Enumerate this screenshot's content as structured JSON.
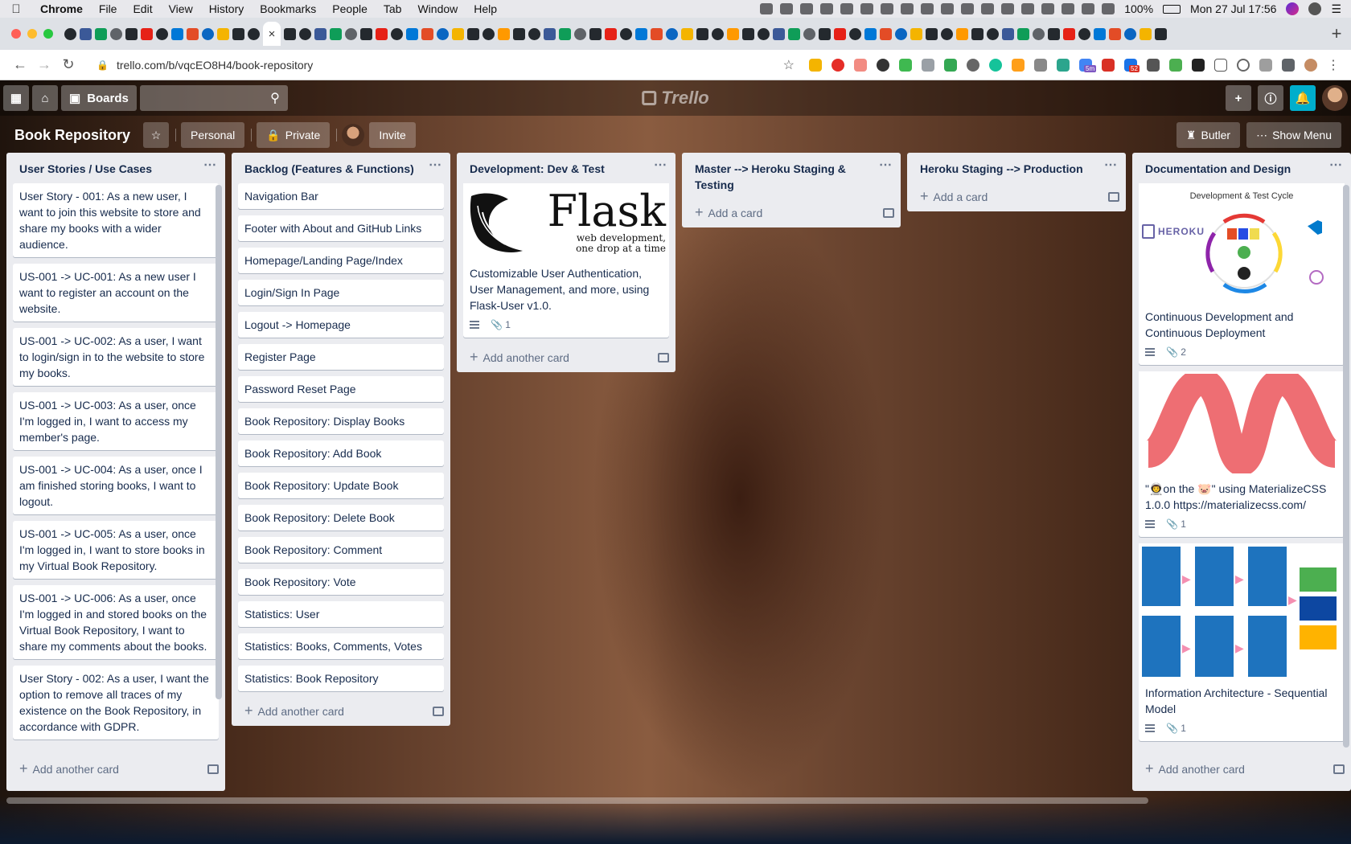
{
  "menubar": {
    "app": "Chrome",
    "items": [
      "File",
      "Edit",
      "View",
      "History",
      "Bookmarks",
      "People",
      "Tab",
      "Window",
      "Help"
    ],
    "battery": "100%",
    "datetime": "Mon 27 Jul  17:56"
  },
  "browser": {
    "url": "trello.com/b/vqcEO8H4/book-repository",
    "badge_5m": "5m",
    "badge_52": "52"
  },
  "trello": {
    "boards_label": "Boards",
    "logo_text": "Trello"
  },
  "board": {
    "title": "Book Repository",
    "team_label": "Personal",
    "visibility_label": "Private",
    "invite_label": "Invite",
    "butler_label": "Butler",
    "show_menu_label": "Show Menu"
  },
  "lists": [
    {
      "title": "User Stories / Use Cases",
      "footer": "Add another card",
      "cards": [
        "User Story - 001: As a new user, I want to join this website to store and share my books with a wider audience.",
        "US-001 -> UC-001: As a new user I want to register an account on the website.",
        "US-001 -> UC-002: As a user, I want to login/sign in to the website to store my books.",
        "US-001 -> UC-003: As a user, once I'm logged in, I want to access my member's page.",
        "US-001 -> UC-004: As a user, once I am finished storing books, I want to logout.",
        "US-001 -> UC-005: As a user, once I'm logged in, I want to store books in my Virtual Book Repository.",
        "US-001 -> UC-006: As a user, once I'm logged in and stored books on the Virtual Book Repository, I want to share my comments about the books.",
        "User Story - 002: As a user, I want the option to remove all traces of my existence on the Book Repository, in accordance with GDPR."
      ]
    },
    {
      "title": "Backlog (Features & Functions)",
      "footer": "Add another card",
      "cards": [
        "Navigation Bar",
        "Footer with About and GitHub Links",
        "Homepage/Landing Page/Index",
        "Login/Sign In Page",
        "Logout -> Homepage",
        "Register Page",
        "Password Reset Page",
        "Book Repository: Display Books",
        "Book Repository: Add Book",
        "Book Repository: Update Book",
        "Book Repository: Delete Book",
        "Book Repository: Comment",
        "Book Repository: Vote",
        "Statistics: User",
        "Statistics: Books, Comments, Votes",
        "Statistics: Book Repository"
      ]
    },
    {
      "title": "Development: Dev & Test",
      "footer": "Add another card",
      "flask_card": {
        "cover_title": "Flask",
        "cover_tagline_1": "web development,",
        "cover_tagline_2": "one drop at a time",
        "text": "Customizable User Authentication, User Management, and more, using Flask-User v1.0.",
        "attachments": "1"
      }
    },
    {
      "title": "Master --> Heroku Staging & Testing",
      "footer": "Add a card"
    },
    {
      "title": "Heroku Staging  --> Production",
      "footer": "Add a card"
    },
    {
      "title": "Documentation and Design",
      "footer": "Add another card",
      "cards": [
        {
          "cover": "devcycle",
          "cover_title": "Development & Test Cycle",
          "cover_brand": "HEROKU",
          "text": "Continuous Development and Continuous Deployment",
          "attachments": "2"
        },
        {
          "cover": "materialize",
          "text": "\"👨‍🚀on the 🐷\" using MaterializeCSS 1.0.0 https://materializecss.com/",
          "attachments": "1"
        },
        {
          "cover": "ia",
          "text": "Information Architecture - Sequential Model",
          "attachments": "1"
        }
      ]
    }
  ],
  "colors": {
    "list_bg": "#ebecf0",
    "card_text": "#172b4d",
    "bell_accent": "#00aecc",
    "materialize_pink": "#ee6e73"
  }
}
